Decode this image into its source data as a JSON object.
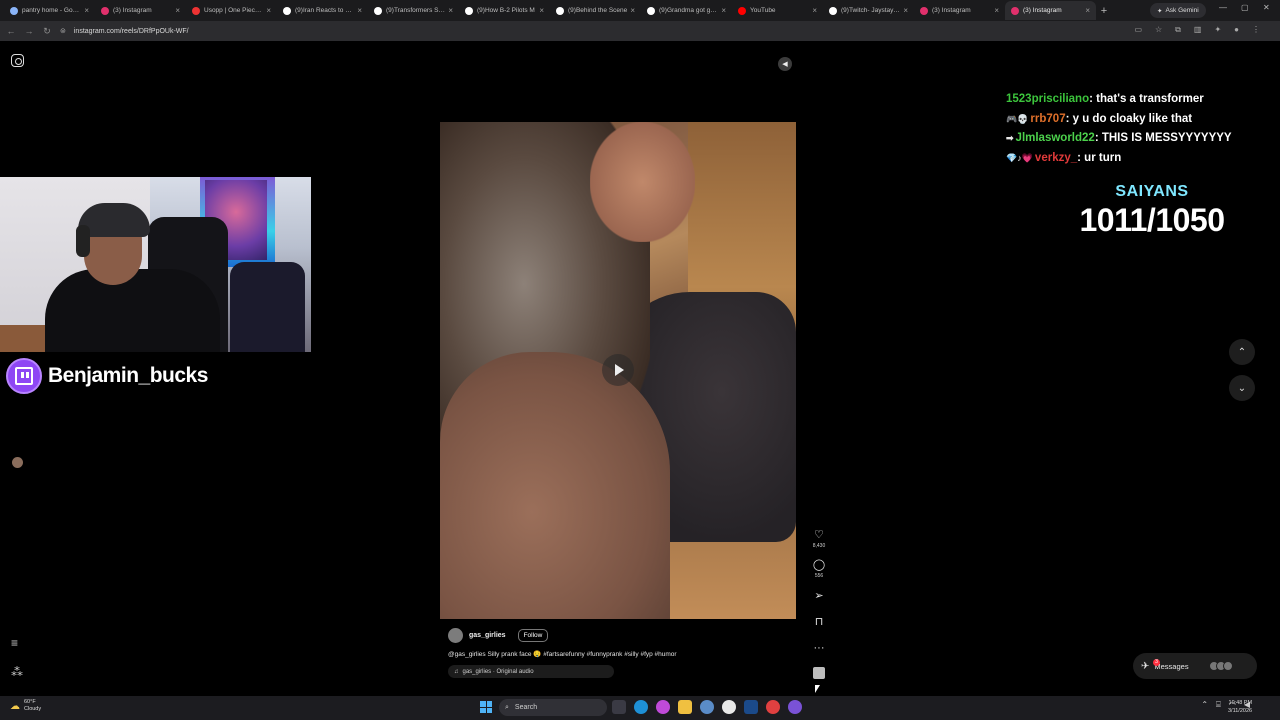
{
  "browser": {
    "tabs": [
      {
        "title": "pantry home - Google",
        "color": "#8ab4f8"
      },
      {
        "title": "(3) Instagram",
        "color": "#e1306c"
      },
      {
        "title": "Usopp | One Piece Li",
        "color": "#e33"
      },
      {
        "title": "(9)Iran Reacts to Viet",
        "color": "#ffffff"
      },
      {
        "title": "(9)Transformers Stor",
        "color": "#ffffff"
      },
      {
        "title": "(9)How B-2 Pilots M",
        "color": "#ffffff"
      },
      {
        "title": "(9)Behind the Scene",
        "color": "#ffffff"
      },
      {
        "title": "(9)Grandma got gam",
        "color": "#ffffff"
      },
      {
        "title": "YouTube",
        "color": "#f00"
      },
      {
        "title": "(9)Twitch- Jaystayup",
        "color": "#ffffff"
      },
      {
        "title": "(3) Instagram",
        "color": "#e1306c"
      },
      {
        "title": "(3) Instagram",
        "color": "#e1306c",
        "active": true
      }
    ],
    "ask_label": "Ask Gemini",
    "url": "instagram.com/reels/DRfPpOUk-WF/"
  },
  "stream": {
    "streamer_name": "Benjamin_bucks",
    "chat": [
      {
        "user": "1523prisciliano",
        "user_color": "#3cc53c",
        "badges": "",
        "message": "that's a transformer"
      },
      {
        "user": "rrb707",
        "user_color": "#e0702a",
        "badges": "🎮💀",
        "message": "y u do cloaky like that"
      },
      {
        "user": "Jlmlasworld22",
        "user_color": "#4cd14c",
        "badges": "➡",
        "message": "THIS IS MESSYYYYYYY"
      },
      {
        "user": "verkzy_",
        "user_color": "#e03a3a",
        "badges": "💎♪💗",
        "message": "ur turn"
      }
    ],
    "goal_label": "SAIYANS",
    "goal_count": "1011/1050"
  },
  "reel": {
    "username": "gas_girlies",
    "follow_label": "Follow",
    "description": "@gas_girlies Silly prank face 🤤 #fartsarefunny #funnyprank #silly #fyp #humor",
    "audio": "gas_girlies · Original audio",
    "likes": "8,430",
    "comments": "556"
  },
  "messages_label": "Messages",
  "messages_badge": "3",
  "taskbar": {
    "weather_temp": "60°F",
    "weather_desc": "Cloudy",
    "search_label": "Search",
    "time": "10:48 PM",
    "date": "3/11/2026"
  }
}
